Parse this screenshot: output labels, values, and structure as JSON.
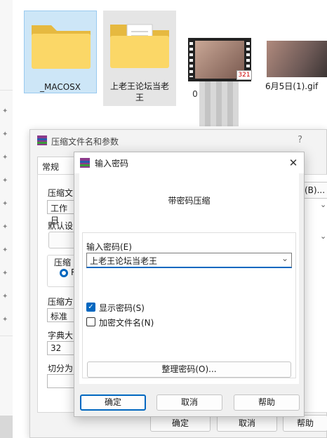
{
  "files": [
    {
      "label": "_MACOSX"
    },
    {
      "label": "上老王论坛当老王"
    },
    {
      "label": "0"
    },
    {
      "label": "6月5日(1).gif"
    }
  ],
  "video_badge": "321",
  "back_dialog": {
    "title": "压缩文件名和参数",
    "help": "?",
    "tab": "常规",
    "archive_label": "压缩文",
    "archive_value": "工作日",
    "browse_button": "(B)...",
    "default_label": "默认设",
    "format_label": "压缩",
    "radio_initial": "R",
    "method_label": "压缩方",
    "method_value": "标准",
    "dict_label": "字典大",
    "dict_value": "32",
    "split_label": "切分为",
    "ok": "确定",
    "cancel": "取消",
    "help_button": "帮助"
  },
  "password_dialog": {
    "title": "输入密码",
    "heading": "带密码压缩",
    "password_label": "输入密码(E)",
    "password_value": "上老王论坛当老王",
    "show_password": "显示密码(S)",
    "show_password_checked": true,
    "encrypt_names": "加密文件名(N)",
    "encrypt_names_checked": false,
    "organize_button": "整理密码(O)...",
    "ok": "确定",
    "cancel": "取消",
    "help": "帮助"
  }
}
